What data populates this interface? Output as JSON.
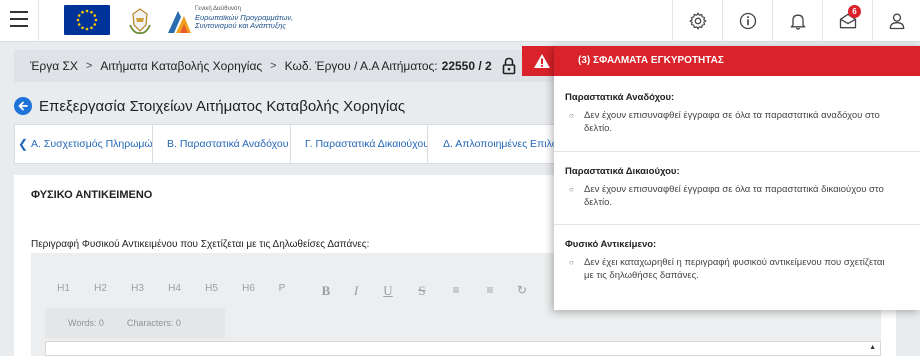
{
  "header": {
    "gov_logo_small": "Γενική Διεύθυνση",
    "gov_logo_line1": "Ευρωπαϊκών Προγραμμάτων,",
    "gov_logo_line2": "Συντονισμού και Ανάπτυξης",
    "notifications_count": "6",
    "icons": [
      "menu-icon",
      "gear-icon",
      "info-icon",
      "bell-icon",
      "mail-icon",
      "user-icon"
    ]
  },
  "breadcrumb": {
    "items": [
      "Έργα ΣΧ",
      "Αιτήματα Καταβολής Χορηγίας",
      "Κωδ. Έργου / Α.Α Αιτήματος:"
    ],
    "code": "22550 / 2",
    "separator": ">"
  },
  "page": {
    "title": "Επεξεργασία Στοιχείων Αιτήματος Καταβολής Χορηγίας"
  },
  "tabs": [
    "Α. Συσχετισμός Πληρωμών",
    "Β. Παραστατικά Αναδόχου",
    "Γ. Παραστατικά Δικαιούχου",
    "Δ. Απλοποιημένες Επιλογές"
  ],
  "section": {
    "heading": "ΦΥΣΙΚΟ ΑΝΤΙΚΕΙΜΕΝΟ",
    "field_label": "Περιγραφή Φυσικού Αντικειμένου που Σχετίζεται με τις Δηλωθείσες Δαπάνες:",
    "words": "Words: 0",
    "characters": "Characters: 0",
    "toolbar": [
      "H1",
      "H2",
      "H3",
      "H4",
      "H5",
      "H6",
      "P"
    ]
  },
  "errors": {
    "header": "(3) ΣΦΑΛΜΑΤΑ ΕΓΚΥΡΟΤΗΤΑΣ",
    "sections": [
      {
        "title": "Παραστατικά Αναδόχου:",
        "item": "Δεν έχουν επισυναφθεί έγγραφα σε όλα τα παραστατικά αναδόχου στο δελτίο."
      },
      {
        "title": "Παραστατικά Δικαιούχου:",
        "item": "Δεν έχουν επισυναφθεί έγγραφα σε όλα τα παραστατικά δικαιούχου στο δελτίο."
      },
      {
        "title": "Φυσικό Αντικείμενο:",
        "item": "Δεν έχει καταχωρηθεί η περιγραφή φυσικού αντικείμενου που σχετίζεται με τις δηλωθήσες δαπάνες."
      }
    ]
  },
  "colors": {
    "accent": "#d9222a",
    "link": "#2368b8",
    "eu_blue": "#003399"
  }
}
